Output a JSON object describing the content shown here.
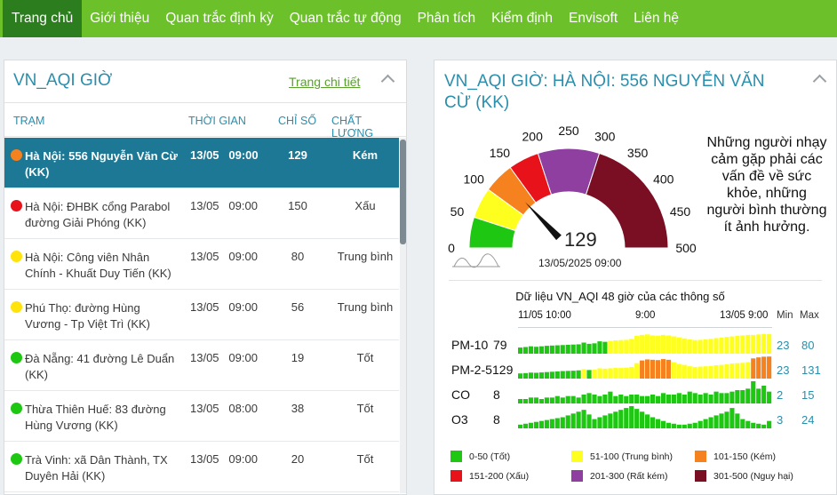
{
  "nav": [
    {
      "label": "Trang chủ",
      "active": true
    },
    {
      "label": "Giới thiệu"
    },
    {
      "label": "Quan trắc định kỳ"
    },
    {
      "label": "Quan trắc tự động"
    },
    {
      "label": "Phân tích"
    },
    {
      "label": "Kiểm định"
    },
    {
      "label": "Envisoft"
    },
    {
      "label": "Liên hệ"
    }
  ],
  "left": {
    "title": "VN_AQI GIỜ",
    "detail_link": "Trang chi tiết",
    "headers": {
      "station": "TRẠM",
      "time": "THỜI GIAN",
      "index": "CHỈ SỐ",
      "quality": "CHẤT LƯỢNG"
    },
    "rows": [
      {
        "name": "Hà Nội: 556 Nguyễn Văn Cừ (KK)",
        "date": "13/05",
        "time": "09:00",
        "value": "129",
        "quality": "Kém",
        "color": "#f6821f",
        "selected": true
      },
      {
        "name": "Hà Nội: ĐHBK cổng Parabol đường Giải Phóng (KK)",
        "date": "13/05",
        "time": "09:00",
        "value": "150",
        "quality": "Xấu",
        "color": "#e8121a"
      },
      {
        "name": "Hà Nội: Công viên Nhân Chính - Khuất Duy Tiến (KK)",
        "date": "13/05",
        "time": "09:00",
        "value": "80",
        "quality": "Trung bình",
        "color": "#ffe30a"
      },
      {
        "name": "Phú Thọ: đường Hùng Vương - Tp Việt Trì (KK)",
        "date": "13/05",
        "time": "09:00",
        "value": "56",
        "quality": "Trung bình",
        "color": "#ffe30a"
      },
      {
        "name": "Đà Nẵng: 41 đường Lê Duẩn (KK)",
        "date": "13/05",
        "time": "09:00",
        "value": "19",
        "quality": "Tốt",
        "color": "#1ec712"
      },
      {
        "name": "Thừa Thiên Huế: 83 đường Hùng Vương (KK)",
        "date": "13/05",
        "time": "08:00",
        "value": "38",
        "quality": "Tốt",
        "color": "#1ec712"
      },
      {
        "name": "Trà Vinh: xã Dân Thành, TX Duyên Hải (KK)",
        "date": "13/05",
        "time": "09:00",
        "value": "20",
        "quality": "Tốt",
        "color": "#1ec712"
      }
    ]
  },
  "right": {
    "title": "VN_AQI GIỜ: HÀ NỘI: 556 NGUYỄN VĂN CỪ (KK)",
    "gauge": {
      "value": 129,
      "value_label": "129",
      "date": "13/05/2025 09:00",
      "ticks": [
        "0",
        "50",
        "100",
        "150",
        "200",
        "250",
        "300",
        "350",
        "400",
        "450",
        "500"
      ],
      "message": "Những người nhạy cảm gặp phải các vấn đề về sức khỏe, những người bình thường ít ảnh hưởng."
    },
    "chart_title": "Dữ liệu VN_AQI 48 giờ của các thông số",
    "x_labels": [
      "11/05 10:00",
      "9:00",
      "13/05 9:00"
    ],
    "min_label": "Min",
    "max_label": "Max",
    "params": [
      {
        "name": "PM-10",
        "value": "79",
        "min": "23",
        "max": "80"
      },
      {
        "name": "PM-2-5",
        "value": "129",
        "min": "23",
        "max": "131"
      },
      {
        "name": "CO",
        "value": "8",
        "min": "2",
        "max": "15"
      },
      {
        "name": "O3",
        "value": "8",
        "min": "3",
        "max": "24"
      }
    ],
    "legend": [
      {
        "label": "0-50 (Tốt)",
        "color": "#1ec712"
      },
      {
        "label": "51-100 (Trung bình)",
        "color": "#ffff1f"
      },
      {
        "label": "101-150 (Kém)",
        "color": "#f6821f"
      },
      {
        "label": "151-200 (Xấu)",
        "color": "#e8121a"
      },
      {
        "label": "201-300 (Rất kém)",
        "color": "#8e3fa0"
      },
      {
        "label": "301-500 (Nguy hại)",
        "color": "#7a0f24"
      }
    ]
  },
  "chart_data": [
    {
      "type": "bar",
      "title": "Dữ liệu VN_AQI 48 giờ của các thông số",
      "x_labels": [
        "11/05 10:00",
        "9:00",
        "13/05 9:00"
      ],
      "series": [
        {
          "name": "PM-10",
          "values": [
            25,
            27,
            30,
            28,
            30,
            32,
            33,
            34,
            35,
            36,
            37,
            38,
            45,
            40,
            42,
            50,
            48,
            52,
            54,
            55,
            56,
            60,
            72,
            76,
            78,
            74,
            73,
            76,
            74,
            70,
            66,
            62,
            58,
            55,
            56,
            58,
            60,
            63,
            65,
            68,
            70,
            72,
            74,
            76,
            76,
            78,
            80,
            79
          ]
        },
        {
          "name": "PM-2-5",
          "values": [
            30,
            32,
            35,
            34,
            36,
            38,
            40,
            42,
            44,
            45,
            46,
            48,
            55,
            50,
            52,
            60,
            58,
            60,
            62,
            62,
            64,
            68,
            90,
            106,
            112,
            110,
            108,
            114,
            110,
            96,
            86,
            80,
            72,
            68,
            70,
            72,
            74,
            78,
            80,
            84,
            88,
            90,
            92,
            96,
            118,
            124,
            128,
            129
          ]
        },
        {
          "name": "CO",
          "values": [
            3,
            3,
            4,
            4,
            3,
            4,
            4,
            5,
            4,
            5,
            5,
            4,
            6,
            7,
            6,
            5,
            6,
            8,
            5,
            6,
            5,
            6,
            6,
            5,
            5,
            6,
            5,
            7,
            6,
            6,
            7,
            6,
            8,
            7,
            6,
            7,
            6,
            8,
            7,
            7,
            8,
            9,
            9,
            10,
            15,
            10,
            12,
            8
          ]
        },
        {
          "name": "O3",
          "values": [
            4,
            5,
            6,
            7,
            8,
            9,
            10,
            11,
            12,
            14,
            16,
            18,
            20,
            15,
            10,
            12,
            14,
            16,
            18,
            20,
            22,
            24,
            21,
            18,
            15,
            12,
            10,
            8,
            6,
            5,
            4,
            4,
            5,
            6,
            8,
            10,
            12,
            14,
            16,
            18,
            22,
            16,
            10,
            8,
            6,
            5,
            4,
            8
          ]
        }
      ]
    }
  ]
}
